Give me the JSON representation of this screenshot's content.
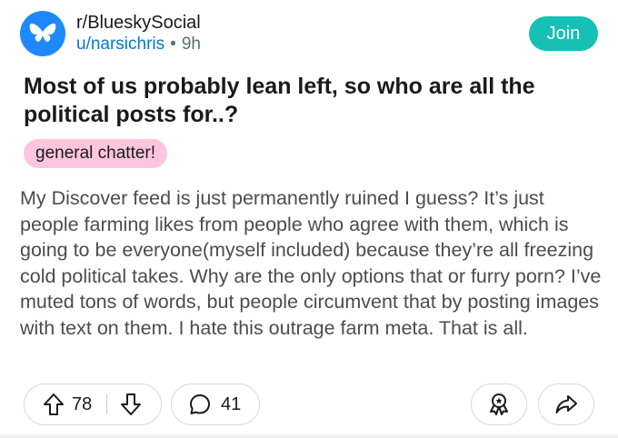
{
  "header": {
    "subreddit": "r/BlueskySocial",
    "username": "u/narsichris",
    "separator": "•",
    "age": "9h",
    "join_label": "Join",
    "avatar_icon": "butterfly-icon"
  },
  "post": {
    "title": "Most of us probably lean left, so who are all the political posts for..?",
    "flair": "general chatter!",
    "body": "My Discover feed is just permanently ruined I guess? It’s just people farming likes from people who agree with them, which is going to be everyone(myself included) because they’re all freezing cold political takes. Why are the only options that or furry porn? I’ve muted tons of words, but people circumvent that by posting images with text on them. I hate this outrage farm meta. That is all."
  },
  "actions": {
    "upvote_icon": "upvote-arrow-icon",
    "vote_count": "78",
    "downvote_icon": "downvote-arrow-icon",
    "comment_icon": "comment-bubble-icon",
    "comment_count": "41",
    "award_icon": "award-icon",
    "share_icon": "share-icon"
  },
  "colors": {
    "avatar_bg": "#1e88ff",
    "join_bg": "#16c0b4",
    "flair_bg": "#ffc4de",
    "username": "#0079d3"
  }
}
